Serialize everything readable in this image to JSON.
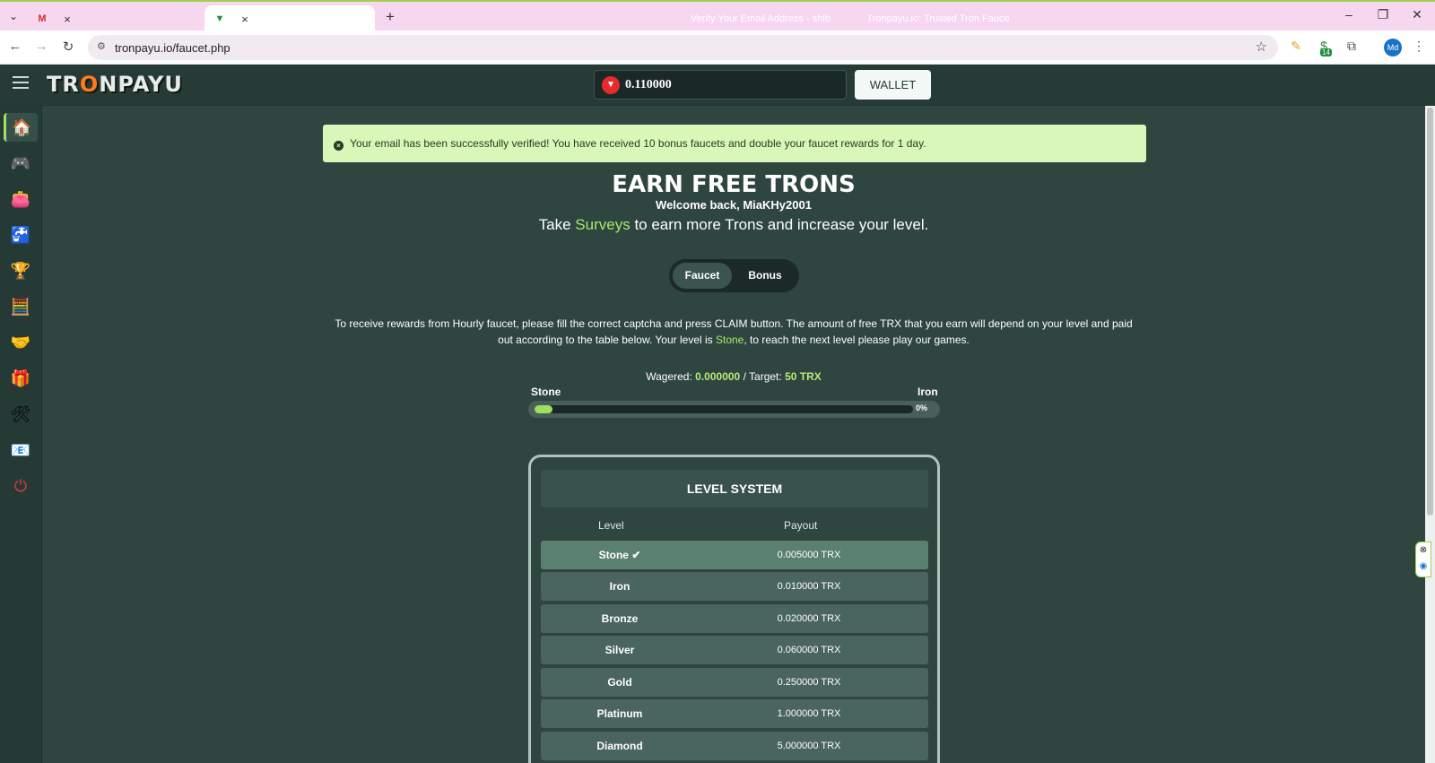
{
  "browser": {
    "tabs": [
      {
        "title": "Verify Your Email Address - shib",
        "active": false,
        "favicon": "gmail-icon"
      },
      {
        "title": "Tronpayu.io: Trusted Tron Fauce",
        "active": true,
        "favicon": "tronpayu-icon"
      }
    ],
    "url": "tronpayu.io/faucet.php",
    "extension_badge": "14",
    "profile_initials": "Md"
  },
  "header": {
    "logo": "TRONPAYU",
    "balance": "0.110000",
    "wallet_label": "WALLET"
  },
  "sidebar": {
    "items": [
      {
        "icon": "home-icon",
        "active": true
      },
      {
        "icon": "gamepad-icon"
      },
      {
        "icon": "wallet-icon"
      },
      {
        "icon": "faucet-icon"
      },
      {
        "icon": "trophy-icon"
      },
      {
        "icon": "calculator-icon"
      },
      {
        "icon": "handshake-icon"
      },
      {
        "icon": "gift-icon"
      },
      {
        "icon": "tools-icon"
      },
      {
        "icon": "mail-icon"
      },
      {
        "icon": "power-icon"
      }
    ]
  },
  "alert": {
    "text": "Your email has been successfully verified! You have received 10 bonus faucets and double your faucet rewards for 1 day."
  },
  "main": {
    "title": "EARN FREE TRONS",
    "welcome": "Welcome back, MiaKHy2001",
    "surveys_prefix": "Take",
    "surveys_link": "Surveys",
    "surveys_suffix": "to earn more Trons and increase your level.",
    "toggle": {
      "faucet": "Faucet",
      "bonus": "Bonus"
    },
    "description_part1": "To receive rewards from Hourly faucet, please fill the correct captcha and press CLAIM button. The amount of free TRX that you earn will depend on your level and paid out according to the table below. Your level is",
    "description_level": "Stone",
    "description_part2": ", to reach the next level please play our games.",
    "wager": {
      "wagered_label": "Wagered:",
      "wagered_value": "0.000000",
      "target_label": "/ Target:",
      "target_value": "50 TRX"
    },
    "progress": {
      "from": "Stone",
      "to": "Iron",
      "percent_label": "0%",
      "percent": 0
    }
  },
  "level_system": {
    "title": "LEVEL SYSTEM",
    "col_level": "Level",
    "col_payout": "Payout",
    "rows": [
      {
        "level": "Stone",
        "payout": "0.005000 TRX",
        "current": true
      },
      {
        "level": "Iron",
        "payout": "0.010000 TRX"
      },
      {
        "level": "Bronze",
        "payout": "0.020000 TRX"
      },
      {
        "level": "Silver",
        "payout": "0.060000 TRX"
      },
      {
        "level": "Gold",
        "payout": "0.250000 TRX"
      },
      {
        "level": "Platinum",
        "payout": "1.000000 TRX"
      },
      {
        "level": "Diamond",
        "payout": "5.000000 TRX"
      }
    ]
  },
  "colors": {
    "accent": "#a8e86a",
    "background": "#2f4540",
    "alert_bg": "#d9f7b8"
  }
}
